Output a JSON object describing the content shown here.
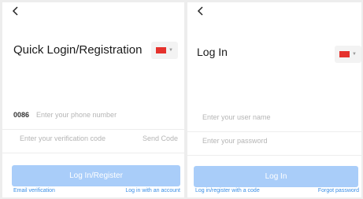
{
  "left_screen": {
    "back_icon": "back-arrow-icon",
    "title": "Quick Login/Registration",
    "country_flag_icon": "china-flag-icon",
    "country_code": "0086",
    "phone_placeholder": "Enter your phone number",
    "code_placeholder": "Enter your verification code",
    "send_code_label": "Send Code",
    "submit_label": "Log In/Register",
    "email_link": "Email verification",
    "account_link": "Log in with an account"
  },
  "right_screen": {
    "back_icon": "back-arrow-icon",
    "title": "Log In",
    "country_flag_icon": "china-flag-icon",
    "username_placeholder": "Enter your user name",
    "password_placeholder": "Enter your password",
    "submit_label": "Log In",
    "code_link": "Log in/register with a code",
    "forgot_link": "Forgot password"
  },
  "colors": {
    "button": "#a9cdf9",
    "link": "#3a8ee6",
    "flag": "#e5322d",
    "placeholder": "#b5b5b5"
  }
}
